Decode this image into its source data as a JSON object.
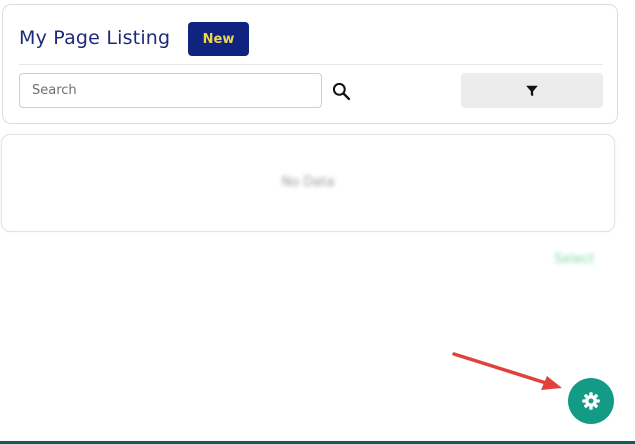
{
  "header": {
    "title": "My Page Listing",
    "new_button_label": "New"
  },
  "toolbar": {
    "search_placeholder": "Search",
    "search_value": "",
    "search_icon": "magnifier-icon",
    "filter_icon": "funnel-icon"
  },
  "content": {
    "empty_text": "No Data"
  },
  "footer": {
    "link_text": "Select"
  },
  "settings": {
    "icon": "gear-icon"
  },
  "annotation": {
    "arrow": "red-arrow-icon"
  },
  "colors": {
    "title": "#1d2a7a",
    "primary_button_bg": "#10237f",
    "primary_button_text": "#f2d64a",
    "fab_bg": "#139b86",
    "arrow": "#e0423b",
    "bottom_bar": "#0f5d54"
  }
}
